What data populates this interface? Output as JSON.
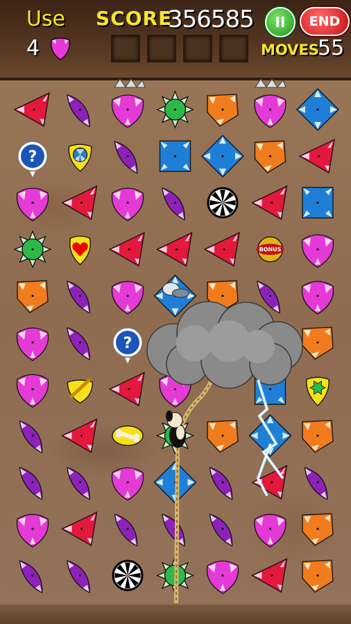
{
  "hud": {
    "use_label": "Use",
    "use_count": "4",
    "use_item_icon": "pink-pig-gem-icon",
    "score_label": "SCORE",
    "score_value": "356585",
    "pause_label": "II",
    "end_label": "END",
    "moves_label": "MOVES",
    "moves_value": "55",
    "empty_slots": 4
  },
  "colors": {
    "red": "#e2183d",
    "purple": "#8e22b8",
    "pink": "#e43ad6",
    "green": "#2fb84a",
    "orange": "#f07c1e",
    "blue": "#1f7fd6",
    "yellow": "#f7e01a"
  },
  "board": {
    "grid": [
      [
        "red-tri",
        "purple-leaf",
        "pink-pig",
        "green-star",
        "orange-kite",
        "pink-pig",
        "blue-diamond"
      ],
      [
        "question-bubble",
        "fan-token",
        "purple-leaf",
        "blue-square",
        "blue-diamond",
        "orange-kite",
        "red-tri"
      ],
      [
        "pink-pig",
        "red-tri",
        "pink-pig",
        "purple-leaf",
        "wheel-token",
        "red-tri",
        "blue-square"
      ],
      [
        "green-star",
        "heart-token",
        "red-tri",
        "red-tri",
        "red-tri",
        "bonus-token",
        "pink-pig"
      ],
      [
        "orange-kite",
        "purple-leaf",
        "pink-pig",
        "husky-diamond",
        "orange-kite",
        "purple-leaf",
        "pink-pig"
      ],
      [
        "pink-pig",
        "purple-leaf",
        "question-bubble",
        "cloud",
        "cloud",
        "cloud",
        "orange-kite"
      ],
      [
        "pink-pig",
        "ruler-token",
        "red-tri",
        "pink-pig",
        "cloud",
        "blue-square",
        "green-gem-token"
      ],
      [
        "purple-leaf",
        "red-tri",
        "bone-token",
        "green-star",
        "orange-kite",
        "blue-diamond",
        "orange-kite"
      ],
      [
        "purple-leaf",
        "purple-leaf",
        "pink-pig",
        "blue-diamond",
        "purple-leaf",
        "red-tri",
        "purple-leaf"
      ],
      [
        "pink-pig",
        "red-tri",
        "purple-leaf",
        "purple-leaf",
        "purple-leaf",
        "pink-pig",
        "orange-kite"
      ],
      [
        "purple-leaf",
        "purple-leaf",
        "wheel-token",
        "green-star",
        "pink-pig",
        "red-tri",
        "orange-kite"
      ]
    ],
    "tokens": {
      "bonus_label": "BONUS"
    },
    "overlays": [
      "storm-cloud",
      "lightning-bolt",
      "climbing-rope",
      "cartoon-dog-climber",
      "husky-dog-sticker",
      "ceiling-spikes"
    ]
  }
}
